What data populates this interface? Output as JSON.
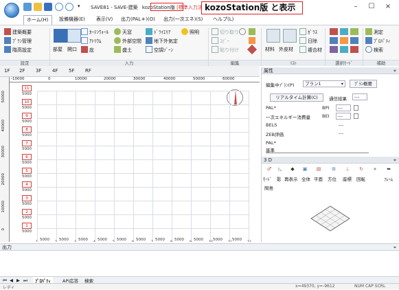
{
  "window": {
    "title": "SAVE81 - SAVE-建築",
    "title_highlight": "kozoStation版",
    "title_tail": "[標準入力法]",
    "callout": "kozoStation版 と表示",
    "minimize": "–",
    "maximize": "☐",
    "close": "×"
  },
  "menu_tabs": [
    "ホーム(H)",
    "設備機器(E)",
    "表示(V)",
    "出力(PAL＊)(O)",
    "出力(一次エネ)(S)",
    "ヘルプ(L)"
  ],
  "ribbon": {
    "input": {
      "group_label": "設定",
      "building_overview": "建築概要",
      "plan_manage": "ﾌﾟﾗﾝ管理",
      "ceiling_height": "階高設定"
    },
    "input2": {
      "group_label": "入力",
      "curtain_wall": "ｶｰﾃﾝｳｫｰﾙ",
      "atrium": "ｱﾄﾘｳﾑ",
      "skylight": "天窓",
      "drylier": "ﾄﾞﾗｲｴﾘｱ",
      "lighting": "照明",
      "room": "部屋",
      "opening": "開口",
      "eaves": "庇",
      "outside_space": "外部空間",
      "underground": "地下外気定",
      "earth_fill": "盛土",
      "ac_zone": "空調ｿﾞｰﾝ"
    },
    "edit": {
      "group_label": "編集",
      "cut": "切り取り",
      "copy": "ｺﾋﾟｰ",
      "paste": "貼り付け"
    },
    "list": {
      "group_label": "ﾘｽﾄ",
      "material": "材料",
      "exterior": "外皮材",
      "glass": "ｶﾞﾗｽ",
      "sunshade": "日除",
      "composite": "複合材"
    },
    "select": {
      "group_label": "選択ﾓｰﾄﾞ"
    },
    "aux": {
      "group_label": "補助",
      "measure": "測定",
      "property": "ﾌﾟﾛﾊﾟﾃｨ",
      "search": "検索"
    }
  },
  "floors": [
    "1F",
    "2F",
    "3F",
    "4F",
    "5F",
    "RF"
  ],
  "ruler": [
    "-10000",
    "0",
    "10000",
    "20000",
    "30000",
    "40000",
    "50000",
    "60000",
    "70000"
  ],
  "vruler": [
    "50000",
    "40000",
    "30000",
    "20000",
    "10000",
    "0"
  ],
  "floor_levels": [
    {
      "n": "11",
      "h": "5000"
    },
    {
      "n": "10",
      "h": "5000"
    },
    {
      "n": "9",
      "h": "5000"
    },
    {
      "n": "8",
      "h": "5000"
    },
    {
      "n": "7",
      "h": "5000"
    },
    {
      "n": "6",
      "h": "5000"
    },
    {
      "n": "5",
      "h": "5000"
    },
    {
      "n": "4",
      "h": "5000"
    },
    {
      "n": "3",
      "h": "5000"
    },
    {
      "n": "2",
      "h": "5000"
    },
    {
      "n": "1",
      "h": "5000"
    }
  ],
  "spans": [
    "5000",
    "5000",
    "5000",
    "5000",
    "5000",
    "5000",
    "5000",
    "5000",
    "5000",
    "5000",
    "5000"
  ],
  "span_marks": [
    "1",
    "2",
    "3",
    "4",
    "5",
    "6",
    "7",
    "8",
    "9",
    "10",
    "11",
    "12",
    "13"
  ],
  "props": {
    "header": "属性",
    "plan_label": "編集中ﾌﾟﾗﾝ(P)",
    "plan_value": "プラン1",
    "plan_overview_button": "ﾌﾟﾗﾝ概要",
    "realtime_button": "リアルタイム計算(C)",
    "result_label": "通信結果",
    "result_value": "---",
    "pal_label": "PAL*",
    "bpi_label": "BPI",
    "pal_dash": "---",
    "energy_label": "一次エネルギー消費量",
    "bei_label": "BEI",
    "energy_dash": "---",
    "bels_label": "BELS",
    "bels_dash": "---",
    "zeb_label": "ZEB評価",
    "zeb_dash": "---",
    "pal_std_label": "PAL*",
    "pal_std_sub": "基準"
  },
  "view3d": {
    "header": "3 D",
    "mode": "ﾓｰﾄﾞ",
    "shadow": "影",
    "redraw": "再表示",
    "whole": "全体",
    "plan": "平面",
    "direction": "方位",
    "coords": "座標",
    "rotate": "回転",
    "frame": "ﾌﾚｰﾑ",
    "status": "問島"
  },
  "output": {
    "header": "出力"
  },
  "sheet_tabs": [
    "ﾌﾟﾛﾊﾟﾃｨ",
    "API応答",
    "検索"
  ],
  "status_bar": {
    "left": "レディ",
    "coords": "x=49370, y=-9612",
    "modes": "NUM  CAP  SCRL"
  },
  "colors": {
    "accent": "#e02020",
    "ribbon_bg": "#f7f7f7",
    "panel_hdr": "#e4e8ee"
  }
}
